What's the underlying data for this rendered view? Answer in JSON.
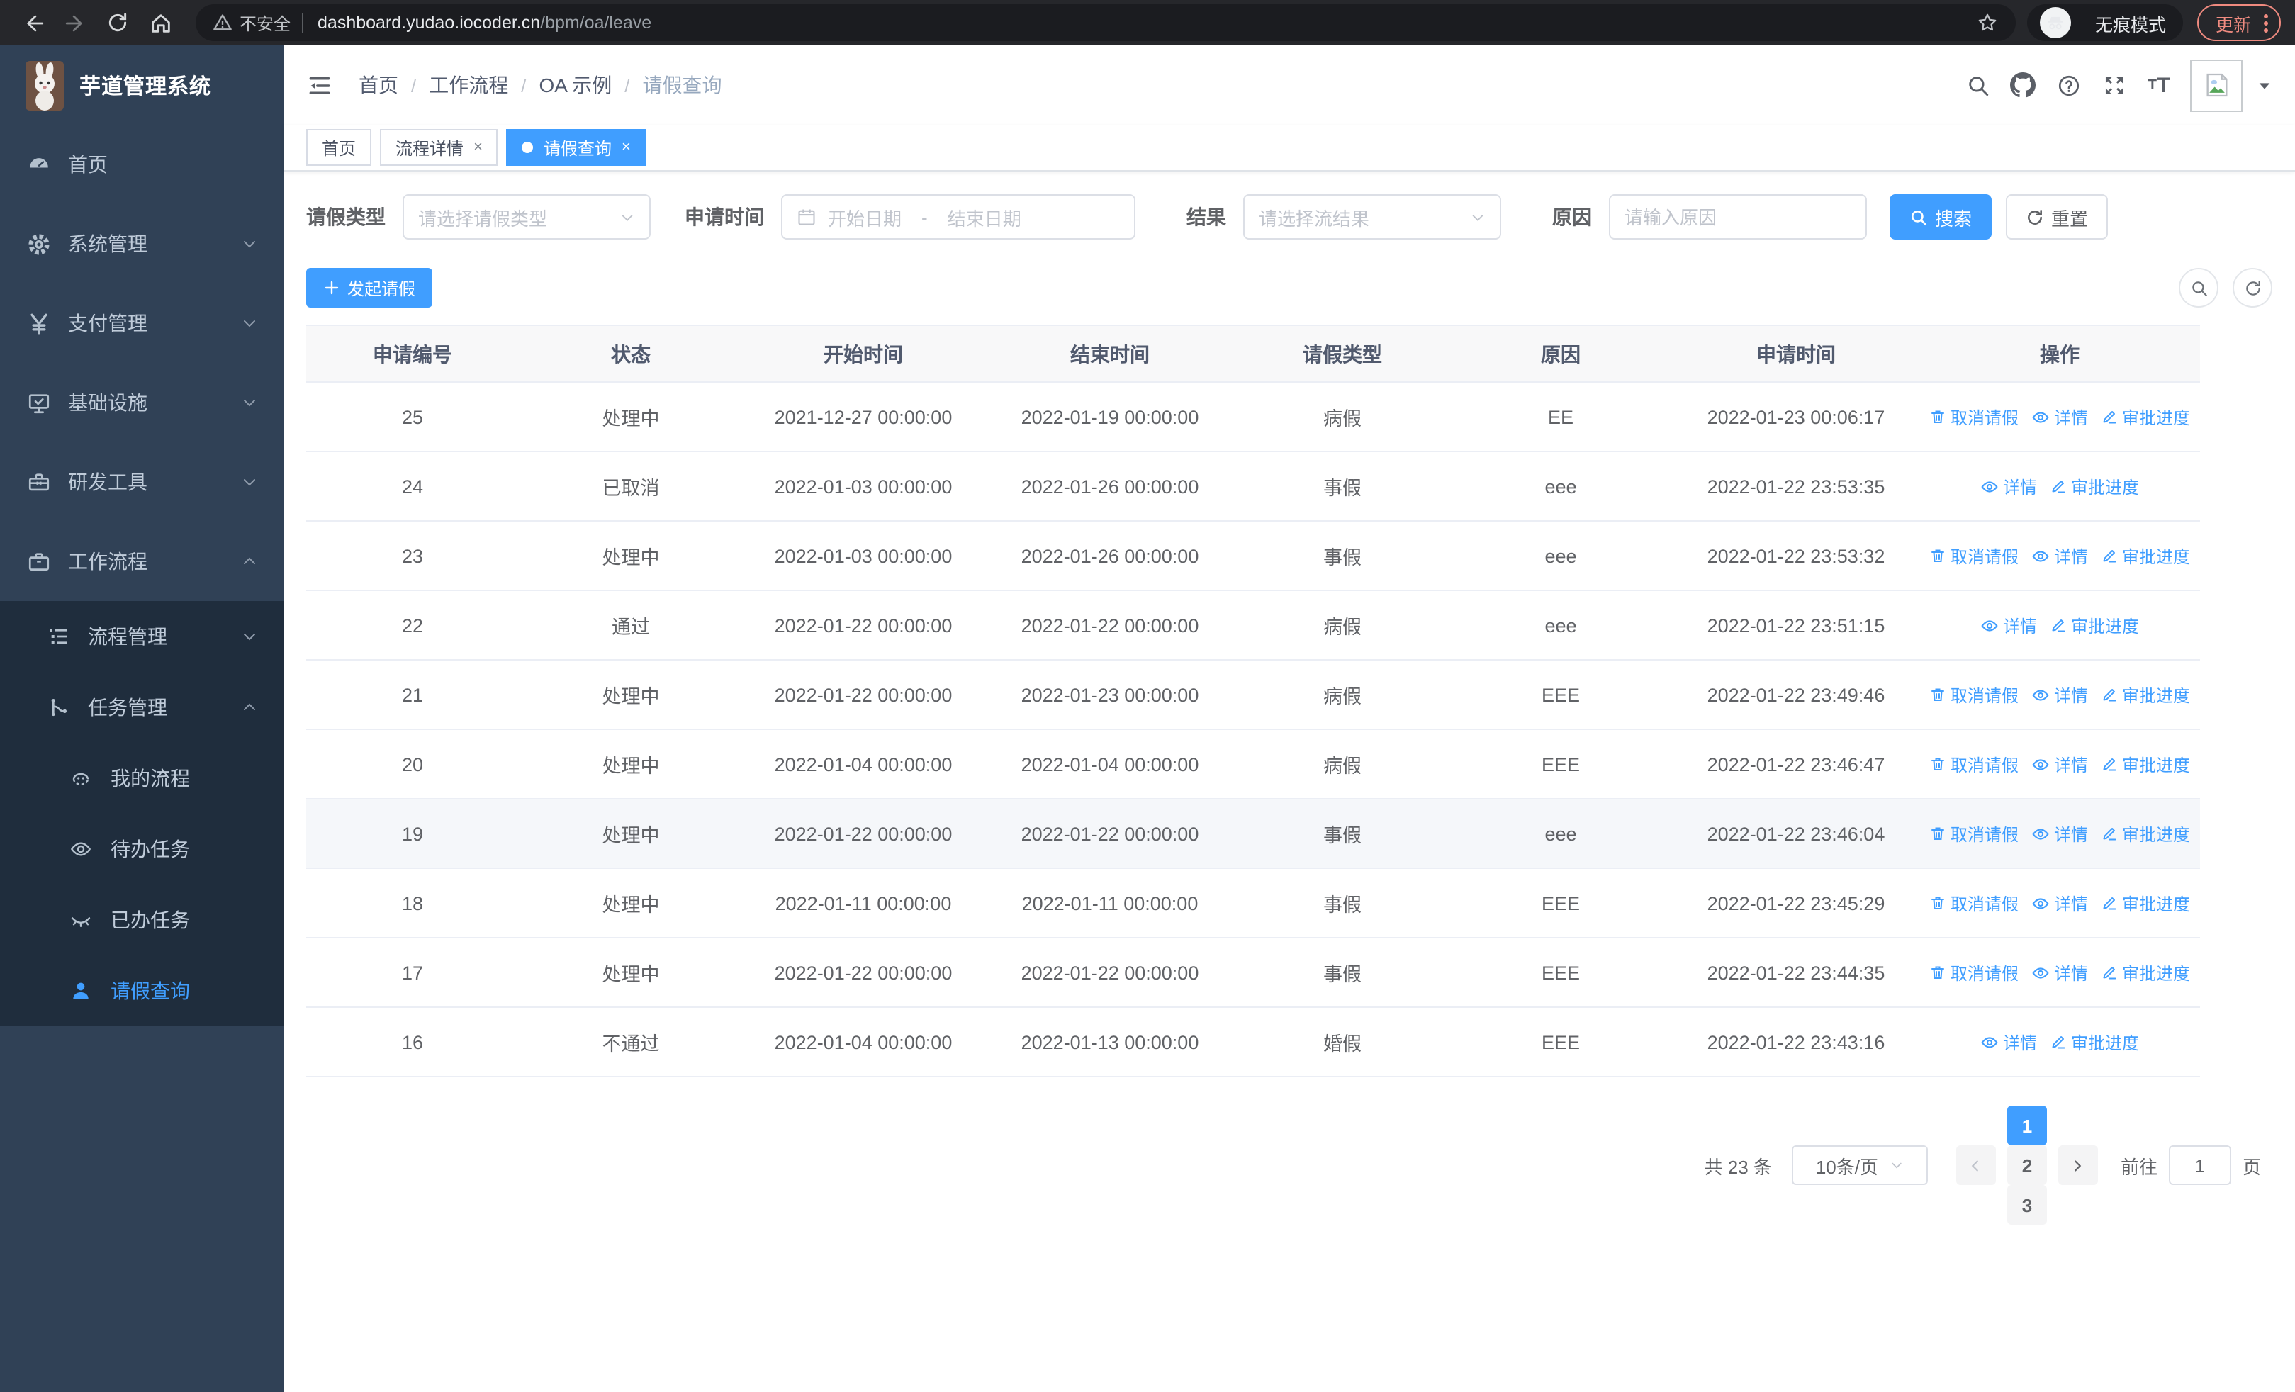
{
  "browser": {
    "security_warning": "不安全",
    "url_domain": "dashboard.yudao.iocoder.cn",
    "url_path": "/bpm/oa/leave",
    "incognito_label": "无痕模式",
    "update_label": "更新"
  },
  "header": {
    "app_title": "芋道管理系统",
    "breadcrumb": [
      "首页",
      "工作流程",
      "OA 示例",
      "请假查询"
    ]
  },
  "tabs": [
    {
      "label": "首页"
    },
    {
      "label": "流程详情"
    },
    {
      "label": "请假查询"
    }
  ],
  "sidebar": {
    "items": [
      {
        "label": "首页"
      },
      {
        "label": "系统管理"
      },
      {
        "label": "支付管理"
      },
      {
        "label": "基础设施"
      },
      {
        "label": "研发工具"
      },
      {
        "label": "工作流程"
      }
    ],
    "submenu": [
      {
        "label": "流程管理"
      },
      {
        "label": "任务管理"
      }
    ],
    "task_children": [
      {
        "label": "我的流程"
      },
      {
        "label": "待办任务"
      },
      {
        "label": "已办任务"
      },
      {
        "label": "请假查询"
      }
    ]
  },
  "filters": {
    "type_label": "请假类型",
    "type_placeholder": "请选择请假类型",
    "time_label": "申请时间",
    "date_start_placeholder": "开始日期",
    "date_separator": "-",
    "date_end_placeholder": "结束日期",
    "result_label": "结果",
    "result_placeholder": "请选择流结果",
    "reason_label": "原因",
    "reason_placeholder": "请输入原因",
    "search_label": "搜索",
    "reset_label": "重置"
  },
  "toolbar": {
    "create_label": "发起请假"
  },
  "table": {
    "columns": [
      "申请编号",
      "状态",
      "开始时间",
      "结束时间",
      "请假类型",
      "原因",
      "申请时间",
      "操作"
    ],
    "action_labels": {
      "cancel": "取消请假",
      "detail": "详情",
      "progress": "审批进度"
    },
    "rows": [
      {
        "id": "25",
        "status": "处理中",
        "start": "2021-12-27 00:00:00",
        "end": "2022-01-19 00:00:00",
        "type": "病假",
        "reason": "EE",
        "apply": "2022-01-23 00:06:17",
        "actions": [
          "cancel",
          "detail",
          "progress"
        ],
        "highlighted": false
      },
      {
        "id": "24",
        "status": "已取消",
        "start": "2022-01-03 00:00:00",
        "end": "2022-01-26 00:00:00",
        "type": "事假",
        "reason": "eee",
        "apply": "2022-01-22 23:53:35",
        "actions": [
          "detail",
          "progress"
        ],
        "highlighted": false
      },
      {
        "id": "23",
        "status": "处理中",
        "start": "2022-01-03 00:00:00",
        "end": "2022-01-26 00:00:00",
        "type": "事假",
        "reason": "eee",
        "apply": "2022-01-22 23:53:32",
        "actions": [
          "cancel",
          "detail",
          "progress"
        ],
        "highlighted": false
      },
      {
        "id": "22",
        "status": "通过",
        "start": "2022-01-22 00:00:00",
        "end": "2022-01-22 00:00:00",
        "type": "病假",
        "reason": "eee",
        "apply": "2022-01-22 23:51:15",
        "actions": [
          "detail",
          "progress"
        ],
        "highlighted": false
      },
      {
        "id": "21",
        "status": "处理中",
        "start": "2022-01-22 00:00:00",
        "end": "2022-01-23 00:00:00",
        "type": "病假",
        "reason": "EEE",
        "apply": "2022-01-22 23:49:46",
        "actions": [
          "cancel",
          "detail",
          "progress"
        ],
        "highlighted": false
      },
      {
        "id": "20",
        "status": "处理中",
        "start": "2022-01-04 00:00:00",
        "end": "2022-01-04 00:00:00",
        "type": "病假",
        "reason": "EEE",
        "apply": "2022-01-22 23:46:47",
        "actions": [
          "cancel",
          "detail",
          "progress"
        ],
        "highlighted": false
      },
      {
        "id": "19",
        "status": "处理中",
        "start": "2022-01-22 00:00:00",
        "end": "2022-01-22 00:00:00",
        "type": "事假",
        "reason": "eee",
        "apply": "2022-01-22 23:46:04",
        "actions": [
          "cancel",
          "detail",
          "progress"
        ],
        "highlighted": true
      },
      {
        "id": "18",
        "status": "处理中",
        "start": "2022-01-11 00:00:00",
        "end": "2022-01-11 00:00:00",
        "type": "事假",
        "reason": "EEE",
        "apply": "2022-01-22 23:45:29",
        "actions": [
          "cancel",
          "detail",
          "progress"
        ],
        "highlighted": false
      },
      {
        "id": "17",
        "status": "处理中",
        "start": "2022-01-22 00:00:00",
        "end": "2022-01-22 00:00:00",
        "type": "事假",
        "reason": "EEE",
        "apply": "2022-01-22 23:44:35",
        "actions": [
          "cancel",
          "detail",
          "progress"
        ],
        "highlighted": false
      },
      {
        "id": "16",
        "status": "不通过",
        "start": "2022-01-04 00:00:00",
        "end": "2022-01-13 00:00:00",
        "type": "婚假",
        "reason": "EEE",
        "apply": "2022-01-22 23:43:16",
        "actions": [
          "detail",
          "progress"
        ],
        "highlighted": false
      }
    ]
  },
  "pagination": {
    "total_text": "共 23 条",
    "page_size": "10条/页",
    "pages": [
      "1",
      "2",
      "3"
    ],
    "active_page": "1",
    "jump_label_prefix": "前往",
    "jump_value": "1",
    "jump_label_suffix": "页"
  },
  "colors": {
    "accent": "#409eff",
    "sidebar": "#304156",
    "submenu": "#1f2d3d"
  }
}
